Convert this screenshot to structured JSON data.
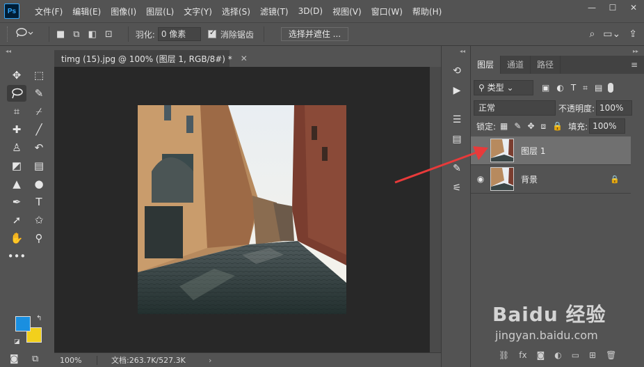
{
  "app": {
    "logo": "Ps"
  },
  "menu": [
    "文件(F)",
    "编辑(E)",
    "图像(I)",
    "图层(L)",
    "文字(Y)",
    "选择(S)",
    "滤镜(T)",
    "3D(D)",
    "视图(V)",
    "窗口(W)",
    "帮助(H)"
  ],
  "window_controls": [
    "minimize-icon",
    "maximize-icon",
    "close-icon"
  ],
  "options_bar": {
    "feather_label": "羽化:",
    "feather_value": "0 像素",
    "antialias_label": "消除锯齿",
    "antialias_checked": true,
    "select_mask_button": "选择并遮住 ..."
  },
  "document": {
    "tab_title": "timg (15).jpg @ 100% (图层 1, RGB/8#) *",
    "zoom": "100%",
    "doc_size": "文档:263.7K/527.3K"
  },
  "toolbar": {
    "foreground_color": "#1a8fe0",
    "background_color": "#f2d01c",
    "tools": [
      "move-tool-icon",
      "marquee-tool-icon",
      "lasso-tool-icon",
      "magic-wand-icon",
      "crop-icon",
      "eyedropper-icon",
      "healing-brush-icon",
      "brush-icon",
      "clone-stamp-icon",
      "history-brush-icon",
      "eraser-icon",
      "gradient-icon",
      "blur-icon",
      "dodge-icon",
      "pen-icon",
      "type-icon",
      "path-selection-icon",
      "shape-icon",
      "hand-icon",
      "zoom-icon",
      "more-tools-icon"
    ]
  },
  "layers_panel": {
    "tabs": [
      "图层",
      "通道",
      "路径"
    ],
    "active_tab": "图层",
    "filter_kind": "类型",
    "blend_mode": "正常",
    "opacity_label": "不透明度:",
    "opacity_value": "100%",
    "lock_label": "锁定:",
    "fill_label": "填充:",
    "fill_value": "100%",
    "layers": [
      {
        "name": "图层 1",
        "selected": true,
        "visible": true,
        "locked": false
      },
      {
        "name": "背景",
        "selected": false,
        "visible": true,
        "locked": true
      }
    ]
  },
  "watermark": {
    "logo": "Baidu 经验",
    "url": "jingyan.baidu.com"
  },
  "annotation": {
    "color": "#e83a3a"
  }
}
